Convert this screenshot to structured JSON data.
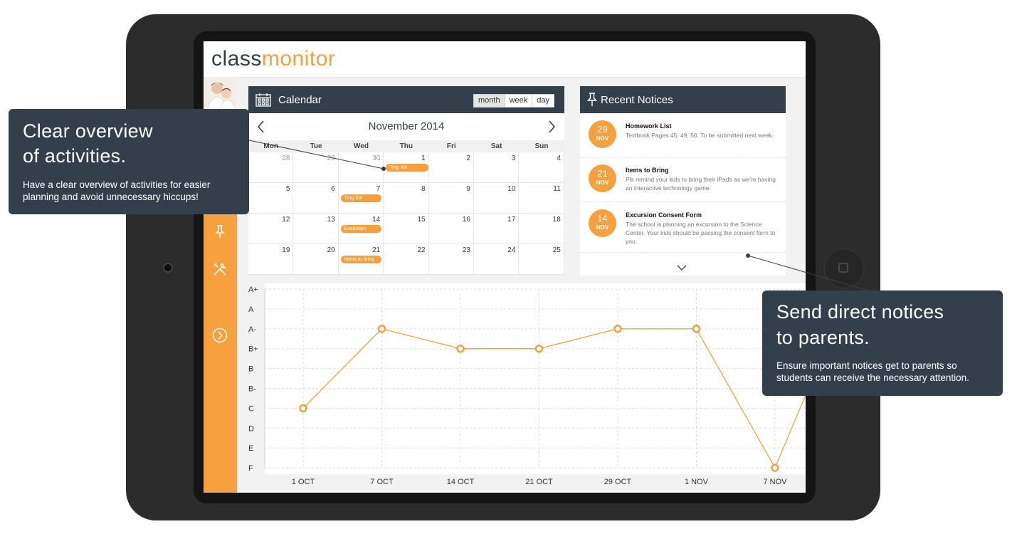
{
  "logo": {
    "part1": "class",
    "part2": "monitor"
  },
  "calendar": {
    "title": "Calendar",
    "views": [
      "month",
      "week",
      "day"
    ],
    "month_label": "November 2014",
    "weekdays": [
      "Mon",
      "Tue",
      "Wed",
      "Thu",
      "Fri",
      "Sat",
      "Sun"
    ],
    "weeks": [
      [
        {
          "n": "28",
          "other": true
        },
        {
          "n": "29",
          "other": true
        },
        {
          "n": "30",
          "other": true
        },
        {
          "n": "1"
        },
        {
          "n": "2"
        },
        {
          "n": "3"
        },
        {
          "n": "4"
        }
      ],
      [
        {
          "n": "5"
        },
        {
          "n": "6"
        },
        {
          "n": "7"
        },
        {
          "n": "8"
        },
        {
          "n": "9"
        },
        {
          "n": "10"
        },
        {
          "n": "11"
        }
      ],
      [
        {
          "n": "12"
        },
        {
          "n": "13"
        },
        {
          "n": "14"
        },
        {
          "n": "15"
        },
        {
          "n": "16"
        },
        {
          "n": "17"
        },
        {
          "n": "18"
        }
      ],
      [
        {
          "n": "19"
        },
        {
          "n": "20"
        },
        {
          "n": "21"
        },
        {
          "n": "22"
        },
        {
          "n": "23"
        },
        {
          "n": "24"
        },
        {
          "n": "25"
        }
      ]
    ],
    "events": [
      {
        "label": "Ting Xie",
        "week": 0,
        "day": 3
      },
      {
        "label": "Ting Xie",
        "week": 1,
        "day": 2
      },
      {
        "label": "Excursion",
        "week": 2,
        "day": 2
      },
      {
        "label": "Items to bring",
        "week": 3,
        "day": 2
      }
    ]
  },
  "notices": {
    "title": "Recent Notices",
    "items": [
      {
        "day": "29",
        "month": "NOV",
        "title": "Homework List",
        "body": "Textbook Pages 45, 49, 50. To be submitted next week."
      },
      {
        "day": "21",
        "month": "NOV",
        "title": "Items to Bring",
        "body": "Pls remind your kids to bring their iPads as we're having an interactive technology game."
      },
      {
        "day": "14",
        "month": "NOV",
        "title": "Excursion Consent Form",
        "body": "The school is planning an excursion to the Science Center. Your kids should be passing the consent form to you."
      }
    ]
  },
  "chart_data": {
    "type": "line",
    "y_categories": [
      "A+",
      "A",
      "A-",
      "B+",
      "B",
      "B-",
      "C",
      "D",
      "E",
      "F"
    ],
    "x": [
      "1 OCT",
      "7 OCT",
      "14 OCT",
      "21 OCT",
      "29 OCT",
      "1 NOV",
      "7 NOV"
    ],
    "values": [
      "C",
      "A-",
      "B+",
      "B+",
      "A-",
      "A-",
      "F"
    ],
    "grid": true,
    "color": "#f5a03d"
  },
  "callout_left": {
    "heading_line1": "Clear overview",
    "heading_line2": "of activities.",
    "text_line1": "Have a clear overview of activities for easier",
    "text_line2": "planning and avoid unnecessary hiccups!"
  },
  "callout_right": {
    "heading_line1": "Send direct notices",
    "heading_line2": "to parents.",
    "text_line1": "Ensure important notices get to parents so",
    "text_line2": "students can receive the necessary attention."
  },
  "colors": {
    "accent": "#f5a03d",
    "dark": "#343f4c",
    "frame": "#2c2c2c"
  },
  "icons": [
    "calendar-icon",
    "pin-icon",
    "tools-icon",
    "arrow-right-circle-icon",
    "chevron-left-icon",
    "chevron-right-icon",
    "chevron-down-icon"
  ]
}
